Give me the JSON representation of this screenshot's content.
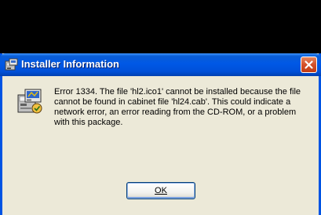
{
  "window": {
    "title": "Installer Information",
    "close_icon": "close-icon",
    "app_icon": "installer-icon"
  },
  "message": {
    "icon": "installer-package-icon",
    "text": "Error 1334. The file 'hl2.ico1' cannot be installed because the file cannot be found in cabinet file 'hl24.cab'. This could indicate a network error, an error reading from the CD-ROM, or a problem with this package."
  },
  "buttons": {
    "ok_label": "OK"
  },
  "colors": {
    "titlebar": "#0058e6",
    "dialog_bg": "#ece9d8",
    "close_button": "#d4502a",
    "background": "#000000"
  }
}
